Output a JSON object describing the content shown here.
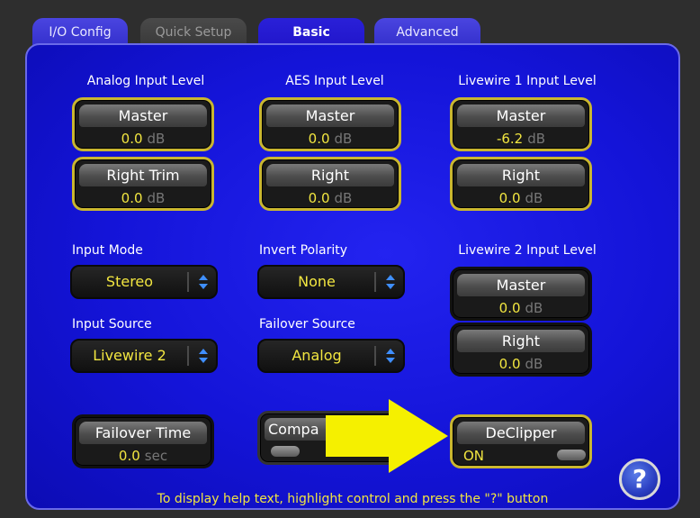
{
  "tabs": [
    {
      "label": "I/O Config"
    },
    {
      "label": "Quick Setup"
    },
    {
      "label": "Basic"
    },
    {
      "label": "Advanced"
    }
  ],
  "analog": {
    "title": "Analog Input Level",
    "master": {
      "label": "Master",
      "value": "0.0",
      "unit": "dB"
    },
    "trim": {
      "label": "Right Trim",
      "value": "0.0",
      "unit": "dB"
    }
  },
  "aes": {
    "title": "AES Input Level",
    "master": {
      "label": "Master",
      "value": "0.0",
      "unit": "dB"
    },
    "right": {
      "label": "Right",
      "value": "0.0",
      "unit": "dB"
    }
  },
  "lw1": {
    "title": "Livewire 1 Input Level",
    "master": {
      "label": "Master",
      "value": "-6.2",
      "unit": "dB"
    },
    "right": {
      "label": "Right",
      "value": "0.0",
      "unit": "dB"
    }
  },
  "lw2": {
    "title": "Livewire 2 Input Level",
    "master": {
      "label": "Master",
      "value": "0.0",
      "unit": "dB"
    },
    "right": {
      "label": "Right",
      "value": "0.0",
      "unit": "dB"
    }
  },
  "input_mode": {
    "title": "Input Mode",
    "value": "Stereo"
  },
  "invert_polarity": {
    "title": "Invert Polarity",
    "value": "None"
  },
  "input_source": {
    "title": "Input Source",
    "value": "Livewire 2"
  },
  "failover_source": {
    "title": "Failover Source",
    "value": "Analog"
  },
  "failover_time": {
    "label": "Failover Time",
    "value": "0.0",
    "unit": "sec"
  },
  "compa": {
    "label": "Compa"
  },
  "declipper": {
    "label": "DeClipper",
    "state": "ON"
  },
  "help": {
    "text": "To display help text, highlight control and press the \"?\" button",
    "button": "?"
  },
  "colors": {
    "panel": "#1414d8",
    "value": "#f2e640",
    "arrow": "#f5f000",
    "highlight": "#c9b630"
  },
  "icons": {
    "dropdown": "up-down-arrows-icon",
    "pointer": "yellow-arrow-icon",
    "help": "question-mark-icon"
  }
}
